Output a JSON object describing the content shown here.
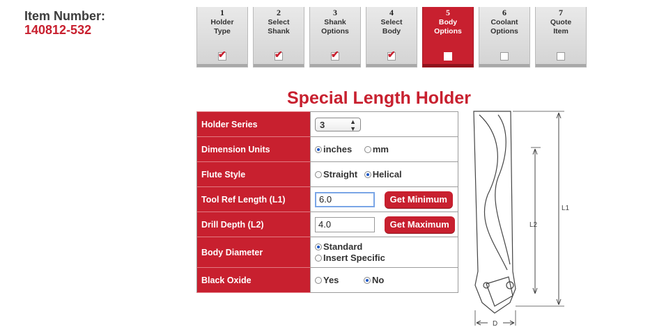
{
  "item": {
    "label": "Item Number:",
    "value": "140812-532"
  },
  "steps": [
    {
      "num": "1",
      "line1": "Holder",
      "line2": "Type",
      "checked": true
    },
    {
      "num": "2",
      "line1": "Select",
      "line2": "Shank",
      "checked": true
    },
    {
      "num": "3",
      "line1": "Shank",
      "line2": "Options",
      "checked": true
    },
    {
      "num": "4",
      "line1": "Select",
      "line2": "Body",
      "checked": true
    },
    {
      "num": "5",
      "line1": "Body",
      "line2": "Options",
      "checked": false,
      "active": true
    },
    {
      "num": "6",
      "line1": "Coolant",
      "line2": "Options",
      "checked": false
    },
    {
      "num": "7",
      "line1": "Quote",
      "line2": "Item",
      "checked": false
    }
  ],
  "title": "Special Length Holder",
  "form": {
    "holder_series": {
      "label": "Holder Series",
      "value": "3"
    },
    "dimension_units": {
      "label": "Dimension Units",
      "options": [
        "inches",
        "mm"
      ],
      "selected": "inches"
    },
    "flute_style": {
      "label": "Flute Style",
      "options": [
        "Straight",
        "Helical"
      ],
      "selected": "Helical"
    },
    "tool_ref_length": {
      "label": "Tool Ref Length (L1)",
      "value": "6.0",
      "button": "Get Minimum"
    },
    "drill_depth": {
      "label": "Drill Depth (L2)",
      "value": "4.0",
      "button": "Get Maximum"
    },
    "body_diameter": {
      "label": "Body Diameter",
      "options": [
        "Standard",
        "Insert Specific"
      ],
      "selected": "Standard"
    },
    "black_oxide": {
      "label": "Black Oxide",
      "options": [
        "Yes",
        "No"
      ],
      "selected": "No"
    }
  },
  "drawing": {
    "l1": "L1",
    "l2": "L2",
    "d": "D"
  },
  "colors": {
    "brand_red": "#c8202f",
    "radio_blue": "#1a56c6"
  }
}
